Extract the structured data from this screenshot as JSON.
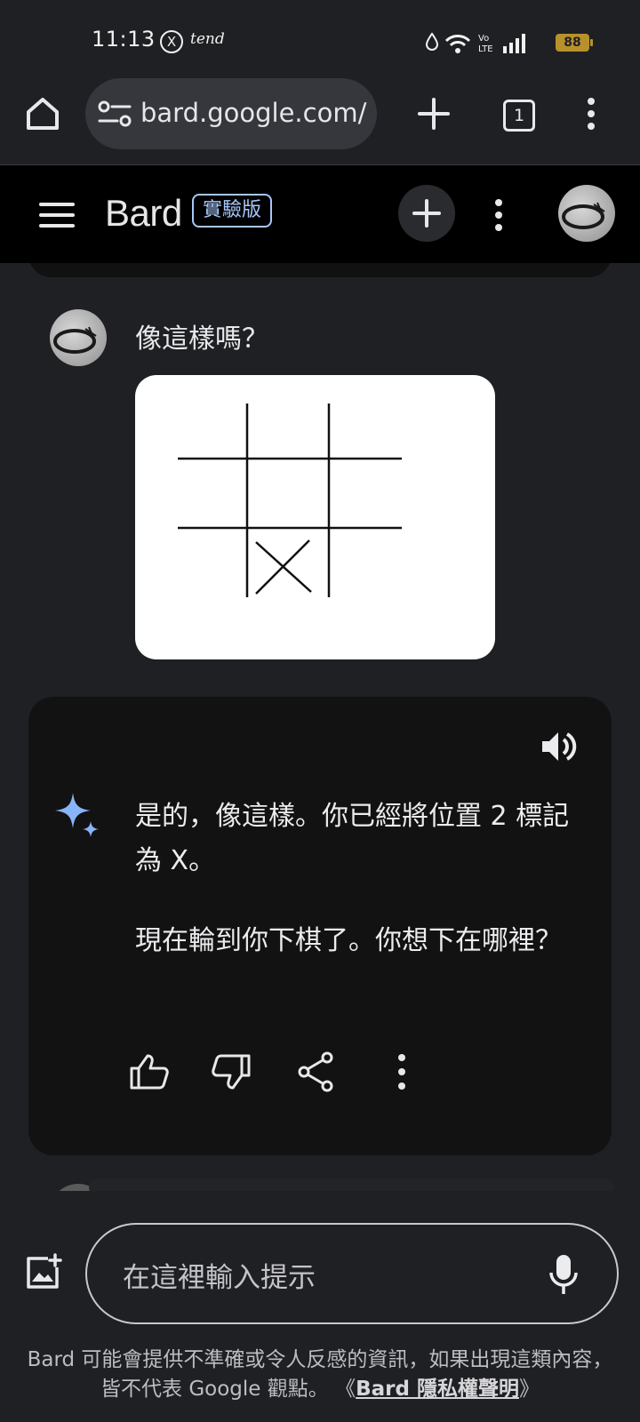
{
  "status_bar": {
    "time": "11:13",
    "x_glyph": "X",
    "tend_label": "tend",
    "battery_level": "88",
    "icons": [
      "water-drop-icon",
      "wifi-icon",
      "volte-icon",
      "signal-icon",
      "battery-icon"
    ]
  },
  "browser": {
    "url": "bard.google.com/",
    "tab_count": "1",
    "icons": [
      "home-icon",
      "site-settings-icon",
      "plus-icon",
      "more-vert-icon"
    ]
  },
  "app_header": {
    "title": "Bard",
    "badge": "實驗版",
    "icons": [
      "menu-icon",
      "plus-icon",
      "more-vert-icon",
      "avatar"
    ]
  },
  "conversation": {
    "user_message": "像這樣嗎？",
    "user_image": {
      "description_icon": "tic-tac-toe-sketch",
      "board": [
        "",
        "",
        "",
        "",
        "",
        "",
        "",
        "X",
        ""
      ]
    },
    "response": {
      "paragraphs": [
        "是的，像這樣。你已經將位置 2 標記為 X。",
        "現在輪到你下棋了。你想下在哪裡？"
      ],
      "actions": [
        "thumb-up-icon",
        "thumb-down-icon",
        "share-icon",
        "more-vert-icon"
      ]
    }
  },
  "composer": {
    "placeholder": "在這裡輸入提示",
    "disclaimer_text": "Bard 可能會提供不準確或令人反感的資訊，如果出現這類內容，皆不代表 Google 觀點。",
    "disclaimer_link_open": "《",
    "disclaimer_link": "Bard 隱私權聲明",
    "disclaimer_link_close": "》"
  },
  "colors": {
    "background": "#1f2023",
    "header": "#000000",
    "card": "#121213",
    "accent": "#a8c7fa",
    "battery": "#b8912a"
  }
}
